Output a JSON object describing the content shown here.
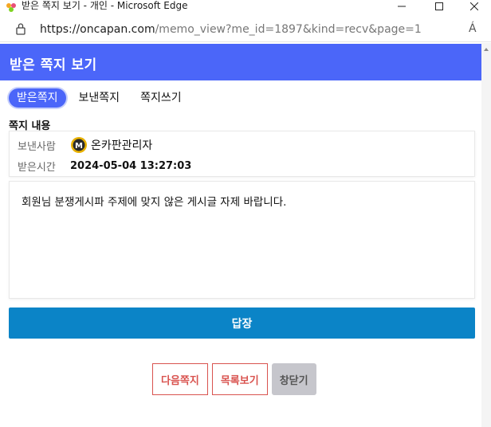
{
  "window": {
    "title": "받은 쪽지 보기 - 개인 - Microsoft Edge",
    "minimize_glyph": "—",
    "maximize_glyph": "☐",
    "close_glyph": "✕"
  },
  "address_bar": {
    "url_domain": "https://oncapan.com",
    "url_path": "/memo_view?me_id=1897&kind=recv&page=1",
    "read_aloud_label": "Á"
  },
  "header": {
    "title": "받은 쪽지 보기",
    "color": "#4b66f9"
  },
  "tabs": [
    {
      "label": "받은쪽지",
      "active": true
    },
    {
      "label": "보낸쪽지",
      "active": false
    },
    {
      "label": "쪽지쓰기",
      "active": false
    }
  ],
  "memo": {
    "section_label": "쪽지 내용",
    "sender_key": "보낸사람",
    "sender_name": "온카판관리자",
    "received_key": "받은시간",
    "received_time": "2024-05-04 13:27:03",
    "content": "회원님 분쟁게시파 주제에 맞지 않은 게시글 자제 바랍니다."
  },
  "actions": {
    "reply_label": "답장",
    "next_label": "다음쪽지",
    "list_label": "목록보기",
    "close_label": "창닫기"
  },
  "colors": {
    "accent": "#4b66f9",
    "reply": "#0b84c7",
    "outline": "#d9534f",
    "grey_button": "#c6c6cc"
  }
}
